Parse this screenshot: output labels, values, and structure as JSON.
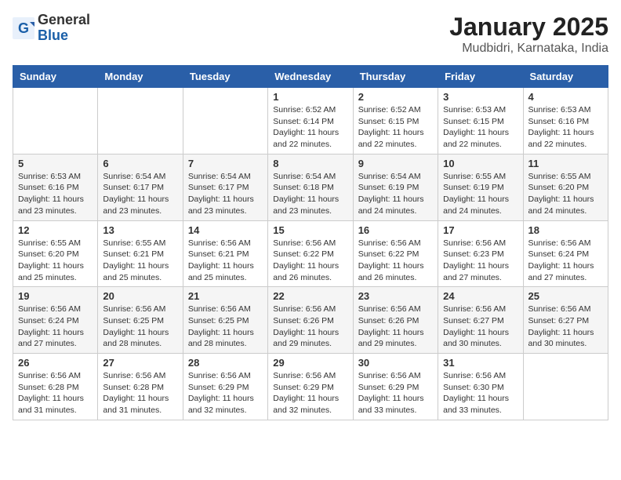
{
  "header": {
    "logo_general": "General",
    "logo_blue": "Blue",
    "title": "January 2025",
    "subtitle": "Mudbidri, Karnataka, India"
  },
  "days_of_week": [
    "Sunday",
    "Monday",
    "Tuesday",
    "Wednesday",
    "Thursday",
    "Friday",
    "Saturday"
  ],
  "weeks": [
    [
      {
        "day": "",
        "info": ""
      },
      {
        "day": "",
        "info": ""
      },
      {
        "day": "",
        "info": ""
      },
      {
        "day": "1",
        "info": "Sunrise: 6:52 AM\nSunset: 6:14 PM\nDaylight: 11 hours\nand 22 minutes."
      },
      {
        "day": "2",
        "info": "Sunrise: 6:52 AM\nSunset: 6:15 PM\nDaylight: 11 hours\nand 22 minutes."
      },
      {
        "day": "3",
        "info": "Sunrise: 6:53 AM\nSunset: 6:15 PM\nDaylight: 11 hours\nand 22 minutes."
      },
      {
        "day": "4",
        "info": "Sunrise: 6:53 AM\nSunset: 6:16 PM\nDaylight: 11 hours\nand 22 minutes."
      }
    ],
    [
      {
        "day": "5",
        "info": "Sunrise: 6:53 AM\nSunset: 6:16 PM\nDaylight: 11 hours\nand 23 minutes."
      },
      {
        "day": "6",
        "info": "Sunrise: 6:54 AM\nSunset: 6:17 PM\nDaylight: 11 hours\nand 23 minutes."
      },
      {
        "day": "7",
        "info": "Sunrise: 6:54 AM\nSunset: 6:17 PM\nDaylight: 11 hours\nand 23 minutes."
      },
      {
        "day": "8",
        "info": "Sunrise: 6:54 AM\nSunset: 6:18 PM\nDaylight: 11 hours\nand 23 minutes."
      },
      {
        "day": "9",
        "info": "Sunrise: 6:54 AM\nSunset: 6:19 PM\nDaylight: 11 hours\nand 24 minutes."
      },
      {
        "day": "10",
        "info": "Sunrise: 6:55 AM\nSunset: 6:19 PM\nDaylight: 11 hours\nand 24 minutes."
      },
      {
        "day": "11",
        "info": "Sunrise: 6:55 AM\nSunset: 6:20 PM\nDaylight: 11 hours\nand 24 minutes."
      }
    ],
    [
      {
        "day": "12",
        "info": "Sunrise: 6:55 AM\nSunset: 6:20 PM\nDaylight: 11 hours\nand 25 minutes."
      },
      {
        "day": "13",
        "info": "Sunrise: 6:55 AM\nSunset: 6:21 PM\nDaylight: 11 hours\nand 25 minutes."
      },
      {
        "day": "14",
        "info": "Sunrise: 6:56 AM\nSunset: 6:21 PM\nDaylight: 11 hours\nand 25 minutes."
      },
      {
        "day": "15",
        "info": "Sunrise: 6:56 AM\nSunset: 6:22 PM\nDaylight: 11 hours\nand 26 minutes."
      },
      {
        "day": "16",
        "info": "Sunrise: 6:56 AM\nSunset: 6:22 PM\nDaylight: 11 hours\nand 26 minutes."
      },
      {
        "day": "17",
        "info": "Sunrise: 6:56 AM\nSunset: 6:23 PM\nDaylight: 11 hours\nand 27 minutes."
      },
      {
        "day": "18",
        "info": "Sunrise: 6:56 AM\nSunset: 6:24 PM\nDaylight: 11 hours\nand 27 minutes."
      }
    ],
    [
      {
        "day": "19",
        "info": "Sunrise: 6:56 AM\nSunset: 6:24 PM\nDaylight: 11 hours\nand 27 minutes."
      },
      {
        "day": "20",
        "info": "Sunrise: 6:56 AM\nSunset: 6:25 PM\nDaylight: 11 hours\nand 28 minutes."
      },
      {
        "day": "21",
        "info": "Sunrise: 6:56 AM\nSunset: 6:25 PM\nDaylight: 11 hours\nand 28 minutes."
      },
      {
        "day": "22",
        "info": "Sunrise: 6:56 AM\nSunset: 6:26 PM\nDaylight: 11 hours\nand 29 minutes."
      },
      {
        "day": "23",
        "info": "Sunrise: 6:56 AM\nSunset: 6:26 PM\nDaylight: 11 hours\nand 29 minutes."
      },
      {
        "day": "24",
        "info": "Sunrise: 6:56 AM\nSunset: 6:27 PM\nDaylight: 11 hours\nand 30 minutes."
      },
      {
        "day": "25",
        "info": "Sunrise: 6:56 AM\nSunset: 6:27 PM\nDaylight: 11 hours\nand 30 minutes."
      }
    ],
    [
      {
        "day": "26",
        "info": "Sunrise: 6:56 AM\nSunset: 6:28 PM\nDaylight: 11 hours\nand 31 minutes."
      },
      {
        "day": "27",
        "info": "Sunrise: 6:56 AM\nSunset: 6:28 PM\nDaylight: 11 hours\nand 31 minutes."
      },
      {
        "day": "28",
        "info": "Sunrise: 6:56 AM\nSunset: 6:29 PM\nDaylight: 11 hours\nand 32 minutes."
      },
      {
        "day": "29",
        "info": "Sunrise: 6:56 AM\nSunset: 6:29 PM\nDaylight: 11 hours\nand 32 minutes."
      },
      {
        "day": "30",
        "info": "Sunrise: 6:56 AM\nSunset: 6:29 PM\nDaylight: 11 hours\nand 33 minutes."
      },
      {
        "day": "31",
        "info": "Sunrise: 6:56 AM\nSunset: 6:30 PM\nDaylight: 11 hours\nand 33 minutes."
      },
      {
        "day": "",
        "info": ""
      }
    ]
  ]
}
